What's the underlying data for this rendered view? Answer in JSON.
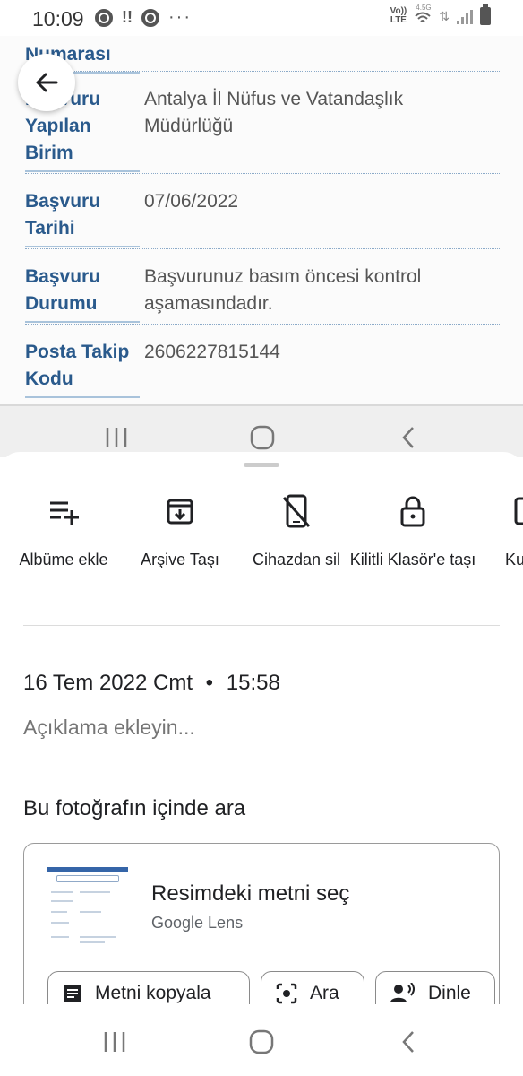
{
  "status_bar": {
    "time": "10:09",
    "network_line1": "Vo))",
    "network_line2": "LTE",
    "data_type": "4.5G"
  },
  "preview": {
    "rows": [
      {
        "label": "Numarası",
        "value": ""
      },
      {
        "label": "Başvuru Yapılan Birim",
        "value": "Antalya İl Nüfus ve Vatandaşlık Müdürlüğü"
      },
      {
        "label": "Başvuru Tarihi",
        "value": "07/06/2022"
      },
      {
        "label": "Başvuru Durumu",
        "value": "Başvurunuz basım öncesi kontrol aşamasındadır."
      },
      {
        "label": "Posta Takip Kodu",
        "value": "2606227815144"
      }
    ]
  },
  "actions": [
    {
      "label": "Albüme ekle",
      "icon": "playlist-add-icon"
    },
    {
      "label": "Arşive Taşı",
      "icon": "archive-icon"
    },
    {
      "label": "Cihazdan sil",
      "icon": "phone-off-icon"
    },
    {
      "label": "Kilitli Klasör'e taşı",
      "icon": "lock-icon"
    },
    {
      "label": "Ku",
      "icon": "device-icon"
    }
  ],
  "details": {
    "date": "16 Tem 2022 Cmt",
    "separator": "•",
    "time": "15:58",
    "description_placeholder": "Açıklama ekleyin..."
  },
  "lens": {
    "section_title": "Bu fotoğrafın içinde ara",
    "card_title": "Resimdeki metni seç",
    "card_subtitle": "Google Lens",
    "chips": [
      {
        "label": "Metni kopyala",
        "icon": "document-icon"
      },
      {
        "label": "Ara",
        "icon": "lens-search-icon"
      },
      {
        "label": "Dinle",
        "icon": "listen-icon"
      }
    ]
  }
}
